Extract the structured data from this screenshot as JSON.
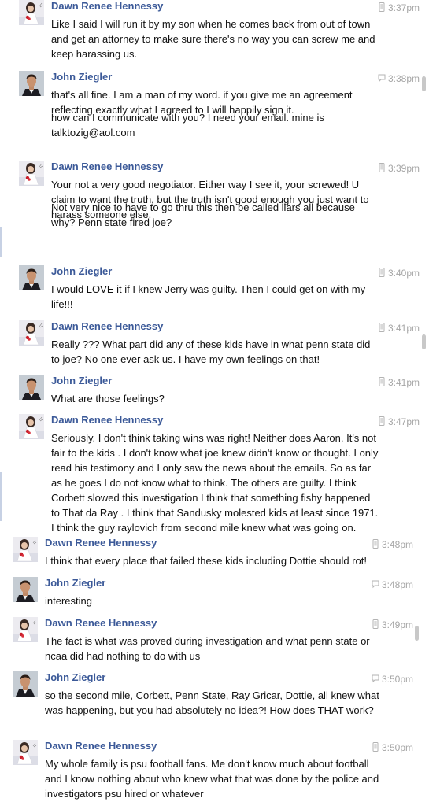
{
  "messages": [
    {
      "sender": "Dawn Renee Hennessy",
      "time": "3:37pm",
      "device": "mobile",
      "avatar": "dawn",
      "paragraphs": [
        "Like I said I will run it by my son when he comes back from out of town and get an attorney to make sure there's no way you can screw me and keep harassing us."
      ]
    },
    {
      "sender": "John Ziegler",
      "time": "3:38pm",
      "device": "chat",
      "avatar": "john",
      "paragraphs": [
        "that's all fine. I am a man of my word. if you give me an agreement reflecting exactly what I agreed to I will happily sign it.",
        "how can I communicate with you? I need your email. mine is talktozig@aol.com"
      ]
    },
    {
      "sender": "Dawn Renee Hennessy",
      "time": "3:39pm",
      "device": "mobile",
      "avatar": "dawn",
      "paragraphs": [
        "Your not a very good negotiator. Either way I see it, your screwed! U claim to want the truth, but the truth isn't good enough you just want to harass someone else.",
        "Not very nice to have to go thru this then be called liars all because why? Penn state fired joe?"
      ]
    },
    {
      "sender": "John Ziegler",
      "time": "3:40pm",
      "device": "mobile",
      "avatar": "john",
      "paragraphs": [
        "I would LOVE it if I knew Jerry was guilty. Then I could get on with my life!!!"
      ]
    },
    {
      "sender": "Dawn Renee Hennessy",
      "time": "3:41pm",
      "device": "mobile",
      "avatar": "dawn",
      "paragraphs": [
        "Really ??? What part did any of these kids have in what penn state did to joe? No one ever ask us. I have my own feelings on that!"
      ]
    },
    {
      "sender": "John Ziegler",
      "time": "3:41pm",
      "device": "mobile",
      "avatar": "john",
      "paragraphs": [
        "What are those feelings?"
      ]
    },
    {
      "sender": "Dawn Renee Hennessy",
      "time": "3:47pm",
      "device": "mobile",
      "avatar": "dawn",
      "paragraphs": [
        "Seriously. I don't think taking wins was right! Neither does Aaron. It's not fair to the kids . I don't know what joe knew didn't know or thought. I only read his testimony and I only saw the news about the emails. So as far as he goes I do not know what to think. The others are guilty. I think Corbett slowed this investigation I think that something fishy happened to That da Ray . I think that Sandusky molested kids at least since 1971. I think the guy raylovich from second mile knew what was going on."
      ]
    },
    {
      "sender": "Dawn Renee Hennessy",
      "time": "3:48pm",
      "device": "mobile",
      "avatar": "dawn",
      "paragraphs": [
        "I think that every place that failed these kids including Dottie should rot!"
      ]
    },
    {
      "sender": "John Ziegler",
      "time": "3:48pm",
      "device": "chat",
      "avatar": "john",
      "paragraphs": [
        "interesting"
      ]
    },
    {
      "sender": "Dawn Renee Hennessy",
      "time": "3:49pm",
      "device": "mobile",
      "avatar": "dawn",
      "paragraphs": [
        "The fact is what was proved during investigation and what penn state or ncaa did had nothing to do with us"
      ]
    },
    {
      "sender": "John Ziegler",
      "time": "3:50pm",
      "device": "chat",
      "avatar": "john",
      "paragraphs": [
        "so the second mile, Corbett, Penn State, Ray Gricar, Dottie, all knew what was happening, but you had absolutely no idea?! How does THAT work?"
      ]
    },
    {
      "sender": "Dawn Renee Hennessy",
      "time": "3:50pm",
      "device": "mobile",
      "avatar": "dawn",
      "paragraphs": [
        "My whole family is psu football fans. Me don't know much about football and I know nothing about who knew what that was done by the police and investigators psu hired or whatever"
      ]
    }
  ]
}
